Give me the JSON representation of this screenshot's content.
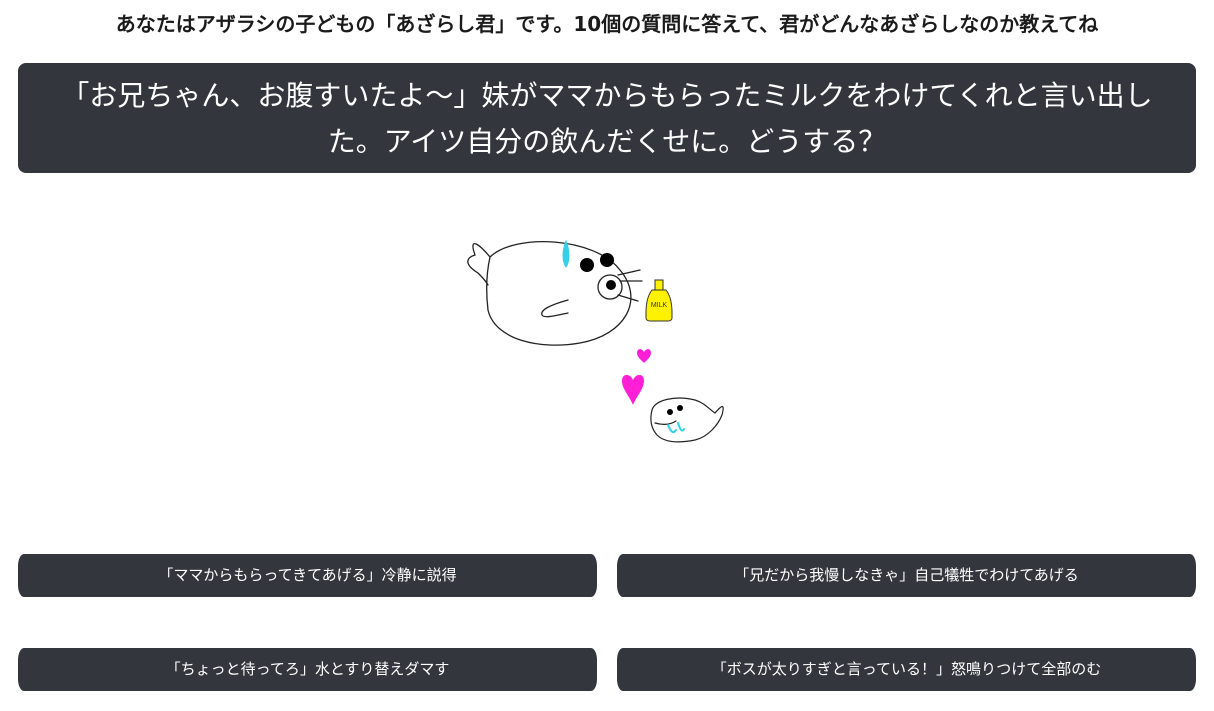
{
  "header": {
    "intro_text": "あなたはアザラシの子どもの「あざらし君」です。10個の質問に答えて、君がどんなあざらしなのか教えてね"
  },
  "question": {
    "text": "「お兄ちゃん、お腹すいたよ～」妹がママからもらったミルクをわけてくれと言い出した。アイツ自分の飲んだくせに。どうする？"
  },
  "illustration": {
    "milk_label": "MILK",
    "colors": {
      "heart": "#ff1fd6",
      "milk_bottle": "#fff200",
      "sweat_drop": "#35d0e8",
      "drool": "#35d0e8"
    }
  },
  "answers": [
    {
      "label": "「ママからもらってきてあげる」冷静に説得"
    },
    {
      "label": "「兄だから我慢しなきゃ」自己犠牲でわけてあげる"
    },
    {
      "label": "「ちょっと待ってろ」水とすり替えダマす"
    },
    {
      "label": "「ボスが太りすぎと言っている！」怒鳴りつけて全部のむ"
    }
  ],
  "theme": {
    "dark_panel": "#33373d",
    "text_light": "#ffffff",
    "text_dark": "#1b1b1b"
  }
}
